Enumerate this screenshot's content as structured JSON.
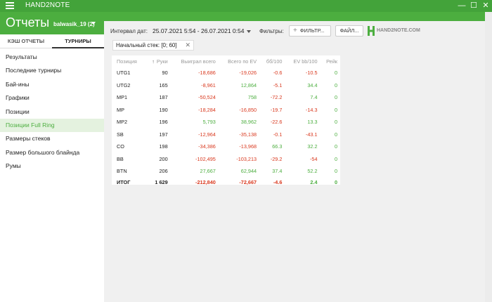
{
  "app": {
    "title": "HAND2NOTE",
    "win_controls": [
      "—",
      "☐",
      "✕"
    ]
  },
  "header": {
    "title": "Отчеты",
    "user": "balwasik_19 (2)"
  },
  "sidebar": {
    "tabs": [
      {
        "label": "КЭШ ОТЧЕТЫ",
        "active": false
      },
      {
        "label": "ТУРНИРЫ",
        "active": true
      }
    ],
    "items": [
      {
        "label": "Результаты"
      },
      {
        "label": "Последние турниры"
      },
      {
        "label": "Бай-ины"
      },
      {
        "label": "Графики"
      },
      {
        "label": "Позиции"
      },
      {
        "label": "Позиции Full Ring",
        "active": true
      },
      {
        "label": "Размеры стеков"
      },
      {
        "label": "Размер большого блайнда"
      },
      {
        "label": "Румы"
      }
    ]
  },
  "toolbar": {
    "interval_label": "Интервал дат:",
    "interval_value": "25.07.2021 5:54 - 26.07.2021 0:54",
    "filters_label": "Фильтры:",
    "filter_button": "ФИЛЬТР...",
    "file_button": "ФАЙЛ...",
    "logo_text": "HAND2NOTE.COM"
  },
  "chip": {
    "label": "Начальный стек: [0; 60]"
  },
  "table": {
    "columns": [
      "Позиция",
      "Руки",
      "Выиграл всего",
      "Всего по EV",
      "бб/100",
      "EV bb/100",
      "Рейк"
    ],
    "rows": [
      [
        "UTG1",
        "90",
        "-18,686",
        "-19,026",
        "-0.6",
        "-10.5",
        "0"
      ],
      [
        "UTG2",
        "165",
        "-8,961",
        "12,864",
        "-5.1",
        "34.4",
        "0"
      ],
      [
        "MP1",
        "187",
        "-50,524",
        "758",
        "-72.2",
        "7.4",
        "0"
      ],
      [
        "MP",
        "190",
        "-18,284",
        "-16,850",
        "-19.7",
        "-14.3",
        "0"
      ],
      [
        "MP2",
        "196",
        "5,793",
        "38,962",
        "-22.6",
        "13.3",
        "0"
      ],
      [
        "SB",
        "197",
        "-12,964",
        "-35,138",
        "-0.1",
        "-43.1",
        "0"
      ],
      [
        "CO",
        "198",
        "-34,386",
        "-13,968",
        "66.3",
        "32.2",
        "0"
      ],
      [
        "BB",
        "200",
        "-102,495",
        "-103,213",
        "-29.2",
        "-54",
        "0"
      ],
      [
        "BTN",
        "206",
        "27,667",
        "62,944",
        "37.4",
        "52.2",
        "0"
      ]
    ],
    "total": [
      "ИТОГ",
      "1 629",
      "-212,840",
      "-72,667",
      "-4.6",
      "2.4",
      "0"
    ]
  },
  "colors": {
    "brand": "#4cae3f",
    "negative": "#d9381e",
    "positive": "#4cae3f"
  }
}
